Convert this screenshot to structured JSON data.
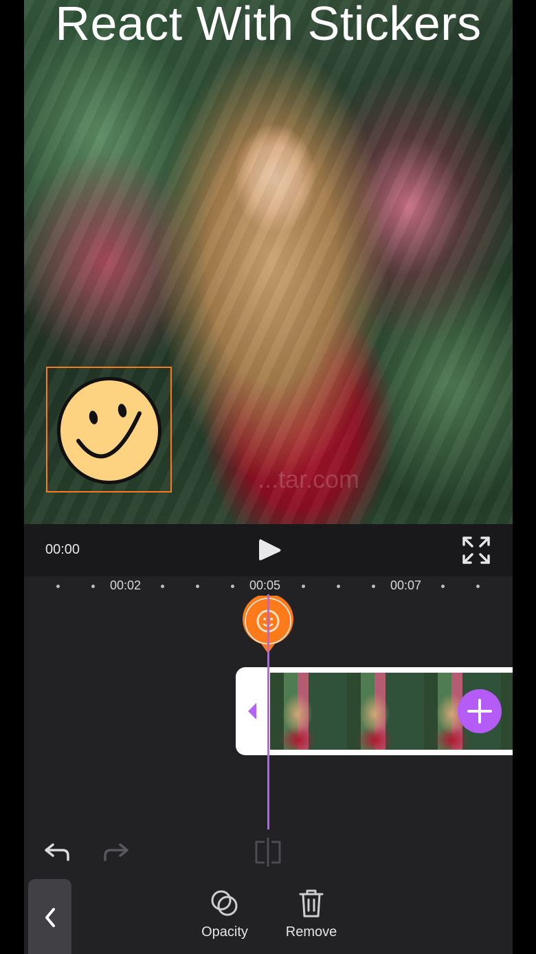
{
  "preview": {
    "title": "React With Stickers",
    "watermark": "...tar.com",
    "sticker": "smiley-face"
  },
  "player": {
    "current_time": "00:00",
    "play_icon": "play-icon",
    "fullscreen_icon": "fullscreen-icon"
  },
  "timeline": {
    "ticks": [
      "00:02",
      "00:05",
      "00:07"
    ],
    "sticker_pin": "smiley-sticker-pin",
    "add_clip_icon": "plus-icon"
  },
  "toolbar": {
    "undo_icon": "undo-icon",
    "redo_icon": "redo-icon",
    "split_icon": "split-icon",
    "back_icon": "chevron-left-icon",
    "opacity_label": "Opacity",
    "remove_label": "Remove"
  },
  "colors": {
    "accent_orange": "#ff7a1a",
    "accent_purple": "#b45cf5",
    "panel": "#222225"
  }
}
